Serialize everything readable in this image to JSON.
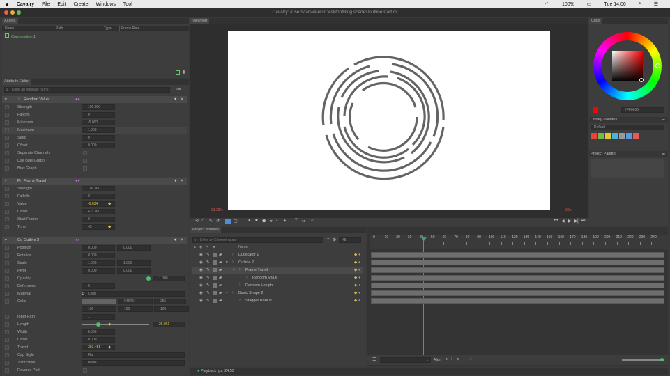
{
  "menubar": {
    "apple": "",
    "app": "Cavalry",
    "items": [
      "File",
      "Edit",
      "Create",
      "Windows",
      "Tool"
    ],
    "battery": "100%",
    "clock": "Tue 14:06"
  },
  "title": "Cavalry: /Users/ianwaters/Desktop/Blog scenes/outlineStart.cv",
  "assets": {
    "tab": "Assets",
    "cols": [
      "Name",
      "Path",
      "Type",
      "Frame Rate"
    ],
    "item": "Composition 1"
  },
  "attr": {
    "tab": "Attribute Editor",
    "search_placeholder": "Enter an Attribute name",
    "random": {
      "title": "Random Value",
      "rows": [
        {
          "label": "Strength",
          "value": "100.000"
        },
        {
          "label": "Falloffs",
          "value": "0"
        },
        {
          "label": "Minimum",
          "value": "-5.000"
        },
        {
          "label": "Maximum",
          "value": "1.000"
        },
        {
          "label": "Seed",
          "value": "0"
        },
        {
          "label": "Offset",
          "value": "0.000"
        },
        {
          "label": "Separate Channels",
          "value": ""
        },
        {
          "label": "Use Bias Graph",
          "value": ""
        },
        {
          "label": "Bias Graph",
          "value": ""
        }
      ]
    },
    "frame": {
      "title": "Frame Travel",
      "rows": [
        {
          "label": "Strength",
          "value": "100.000"
        },
        {
          "label": "Falloffs",
          "value": "0"
        },
        {
          "label": "Value",
          "value": "-0.634"
        },
        {
          "label": "Offset",
          "value": "421.000"
        },
        {
          "label": "Start Frame",
          "value": "0"
        },
        {
          "label": "Time",
          "value": "45"
        }
      ]
    },
    "outline": {
      "title": "Outline 2",
      "position": [
        "0.000",
        "0.000"
      ],
      "rotation": "0.000",
      "scale": [
        "1.000",
        "1.000"
      ],
      "pivot": [
        "0.000",
        "0.000"
      ],
      "opacity": "1.000",
      "deformers": "0",
      "material": "Color",
      "color_hex": "646464",
      "color_a": "255",
      "color_rgb": [
        "100",
        "100",
        "100"
      ],
      "input_path": "1",
      "length": "26.961",
      "width": "8.000",
      "offset": "0.000",
      "travel": "383.451",
      "cap_style": "Flat",
      "joint_style": "Bevel",
      "labels": {
        "position": "Position",
        "rotation": "Rotation",
        "scale": "Scale",
        "pivot": "Pivot",
        "opacity": "Opacity",
        "deformers": "Deformers",
        "material": "Material",
        "color": "Color",
        "input_path": "Input Path",
        "length": "Length",
        "width": "Width",
        "offset": "Offset",
        "travel": "Travel",
        "cap_style": "Cap Style",
        "joint_style": "Joint Style",
        "reverse_path": "Reverse Path"
      }
    }
  },
  "viewport": {
    "tab": "Viewport",
    "zoom": "93.28%",
    "fps_label": "30fr"
  },
  "color": {
    "tab": "Color",
    "hex": "#FF0000",
    "library": "Library Palettes",
    "palette": "Default",
    "project": "Project Palette",
    "accent": "#ff0000",
    "swatches": [
      "#e8463c",
      "#76b84a",
      "#e6c53a",
      "#4ab4d8",
      "#9a9a9a",
      "#5a98e0",
      "#e85a5a"
    ]
  },
  "project": {
    "tab": "Project Window",
    "search_placeholder": "Enter an Element name",
    "frame": "45",
    "name_col": "Name",
    "layers": [
      {
        "name": "Duplicator 1",
        "indent": 0
      },
      {
        "name": "Outline 2",
        "indent": 0
      },
      {
        "name": "Frame Travel",
        "indent": 1
      },
      {
        "name": "Random Value",
        "indent": 2
      },
      {
        "name": "Random Length",
        "indent": 1
      },
      {
        "name": "Basic Shape 2",
        "indent": 0
      },
      {
        "name": "Stagger Radius",
        "indent": 1
      }
    ]
  },
  "timeline": {
    "ticks": [
      "0",
      "10",
      "20",
      "30",
      "40",
      "50",
      "60",
      "70",
      "80",
      "90",
      "100",
      "110",
      "120",
      "130",
      "140",
      "150",
      "160",
      "170",
      "180",
      "190",
      "200",
      "210",
      "220",
      "230",
      "240"
    ],
    "current": "45",
    "align": "Align"
  },
  "status": {
    "fps": "Playback fps: 24.59"
  }
}
